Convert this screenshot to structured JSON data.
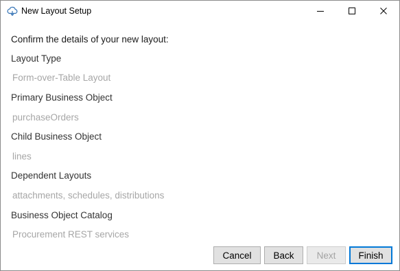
{
  "window": {
    "title": "New Layout Setup",
    "app_icon": "cloud-icon",
    "controls": [
      "minimize-icon",
      "maximize-icon",
      "close-icon"
    ]
  },
  "summary": {
    "heading": "Confirm the details of your new layout:",
    "fields": [
      {
        "label": "Layout Type",
        "value": "Form-over-Table Layout"
      },
      {
        "label": "Primary Business Object",
        "value": "purchaseOrders"
      },
      {
        "label": "Child Business Object",
        "value": "lines"
      },
      {
        "label": "Dependent Layouts",
        "value": "attachments, schedules, distributions"
      },
      {
        "label": "Business Object Catalog",
        "value": "Procurement REST services"
      }
    ]
  },
  "buttons": {
    "cancel": "Cancel",
    "back": "Back",
    "next": "Next",
    "finish": "Finish"
  },
  "colors": {
    "accent": "#0078d7",
    "value_text": "#a6a6a6",
    "button_face": "#e1e1e1"
  }
}
